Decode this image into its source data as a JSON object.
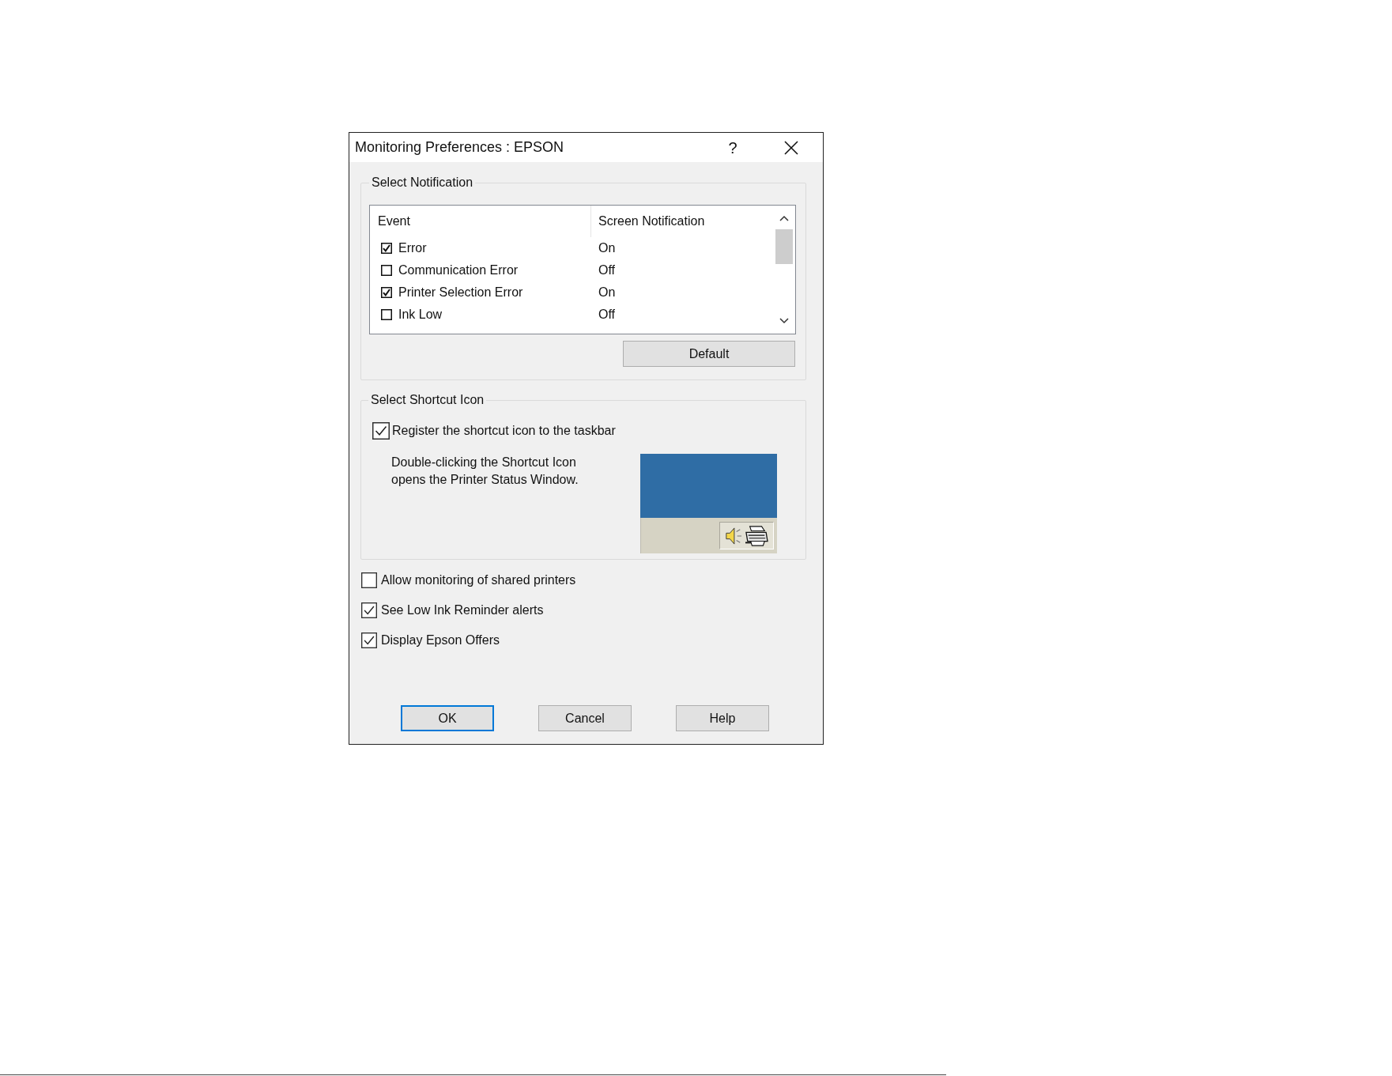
{
  "window": {
    "title": "Monitoring Preferences : EPSON",
    "help_button": "?"
  },
  "select_notification": {
    "title": "Select Notification",
    "columns": [
      "Event",
      "Screen Notification"
    ],
    "rows": [
      {
        "checked": true,
        "event": "Error",
        "screen_notification": "On"
      },
      {
        "checked": false,
        "event": "Communication Error",
        "screen_notification": "Off"
      },
      {
        "checked": true,
        "event": "Printer Selection Error",
        "screen_notification": "On"
      },
      {
        "checked": false,
        "event": "Ink Low",
        "screen_notification": "Off"
      }
    ],
    "default_button": "Default"
  },
  "select_shortcut_icon": {
    "title": "Select Shortcut Icon",
    "register": {
      "label": "Register the shortcut icon to the taskbar",
      "checked": true
    },
    "description": "Double-clicking the Shortcut Icon opens the Printer Status Window."
  },
  "options": [
    {
      "label": "Allow monitoring of shared printers",
      "checked": false
    },
    {
      "label": "See Low Ink Reminder alerts",
      "checked": true
    },
    {
      "label": "Display Epson Offers",
      "checked": true
    }
  ],
  "buttons": [
    {
      "label": "OK",
      "default": true
    },
    {
      "label": "Cancel",
      "default": false
    },
    {
      "label": "Help",
      "default": false
    }
  ]
}
